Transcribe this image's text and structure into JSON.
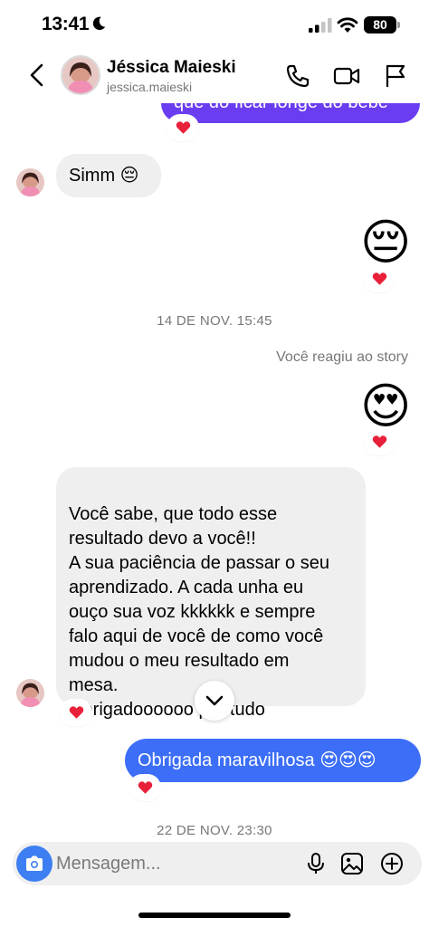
{
  "status_bar": {
    "time": "13:41",
    "battery": "80"
  },
  "header": {
    "name": "Jéssica Maieski",
    "username": "jessica.maieski"
  },
  "messages": {
    "prev_outgoing": "que do ficar longe do bebe",
    "simm": "Simm 😔",
    "emoji_pensive": "😔",
    "date1": "14 DE NOV. 15:45",
    "story_reaction_note": "Você reagiu ao story",
    "emoji_heart_eyes": "😍",
    "long_message": "Você sabe, que todo esse\nresultado devo a você!!\nA sua paciência de passar o seu\naprendizado. A cada unha eu\nouço sua voz kkkkkk e sempre\nfalo aqui de você  de como você\nmudou o meu resultado em\nmesa.\nObrigadoooooo por tudo",
    "reply": "Obrigada maravilhosa 😍😍😍",
    "date2": "22 DE NOV. 23:30"
  },
  "composer": {
    "placeholder": "Mensagem..."
  },
  "colors": {
    "outgoing_purple": "#6a3df0",
    "outgoing_blue": "#3c6ef7",
    "incoming_gray": "#efefef",
    "reaction_red": "#e8203a"
  }
}
